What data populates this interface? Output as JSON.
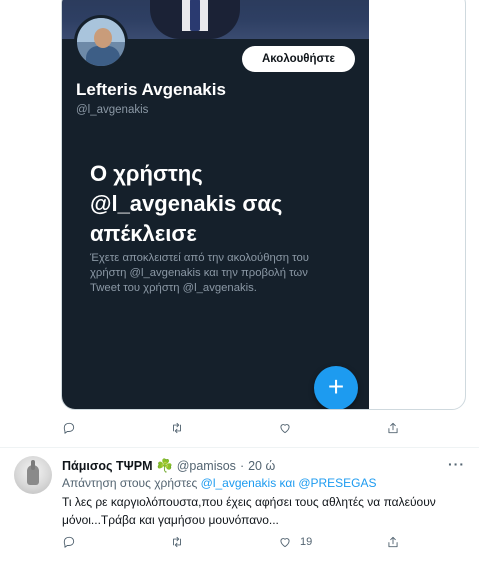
{
  "embedded_profile": {
    "follow_label": "Ακολουθήστε",
    "name": "Lefteris Avgenakis",
    "handle": "@l_avgenakis",
    "blocked_title": "Ο χρήστης @l_avgenakis σας απέκλεισε",
    "blocked_description": "Έχετε αποκλειστεί από την ακολούθηση του χρήστη @l_avgenakis και την προβολή των Tweet του χρήστη @l_avgenakis.",
    "fab_symbol": "+"
  },
  "first_tweet_actions": {
    "icons": [
      "reply-icon",
      "retweet-icon",
      "like-icon",
      "share-icon"
    ]
  },
  "tweet": {
    "name": "Πάμισος ΤΨΡΜ",
    "emoji": "☘️",
    "handle": "@pamisos",
    "separator": "·",
    "time": "20 ώ",
    "reply_prefix": "Απάντηση στους χρήστες",
    "reply_to": "@l_avgenakis και @PRESEGAS",
    "text": "Τι λες ρε καργιολόπουστα,που έχεις αφήσει τους αθλητές να παλεύουν μόνοι...Τράβα και γαμήσου μουνόπανο...",
    "like_count": "19",
    "more_symbol": "···"
  },
  "colors": {
    "accent": "#1d9bf0",
    "dark_bg": "#15202b",
    "muted": "#536471",
    "clover": "#2e9e3e"
  }
}
